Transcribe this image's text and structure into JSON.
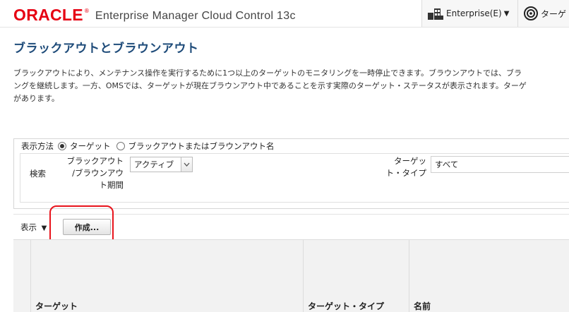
{
  "header": {
    "logo": "ORACLE",
    "logo_mark": "®",
    "product": "Enterprise Manager Cloud Control 13c",
    "enterprise_menu": "Enterprise(E)",
    "targets_menu": "ターゲ"
  },
  "page": {
    "title": "ブラックアウトとブラウンアウト",
    "description": [
      "ブラックアウトにより、メンテナンス操作を実行するために1つ以上のターゲットのモニタリングを一時停止できます。ブラウンアウトでは、ブラ",
      "ングを継続します。一方、OMSでは、ターゲットが現在ブラウンアウト中であることを示す実際のターゲット・ステータスが表示されます。ターゲ",
      "があります。"
    ]
  },
  "filter": {
    "show_by_label": "表示方法",
    "option_target": "ターゲット",
    "option_name": "ブラックアウトまたはブラウンアウト名",
    "search_label": "検索",
    "period_label_lines": [
      "ブラックアウト",
      "/ブラウンアウ",
      "ト期間"
    ],
    "period_value": "アクティブ",
    "target_type_label_lines": [
      "ターゲッ",
      "ト・タイプ"
    ],
    "target_type_value": "すべて"
  },
  "toolbar": {
    "view_label": "表示",
    "create_label": "作成..."
  },
  "table": {
    "columns": [
      "",
      "ターゲット",
      "ターゲット・タイプ",
      "名前"
    ]
  },
  "colors": {
    "brand_red": "#e60012",
    "title_blue": "#1f4c7a",
    "highlight_red": "#e8141c"
  }
}
